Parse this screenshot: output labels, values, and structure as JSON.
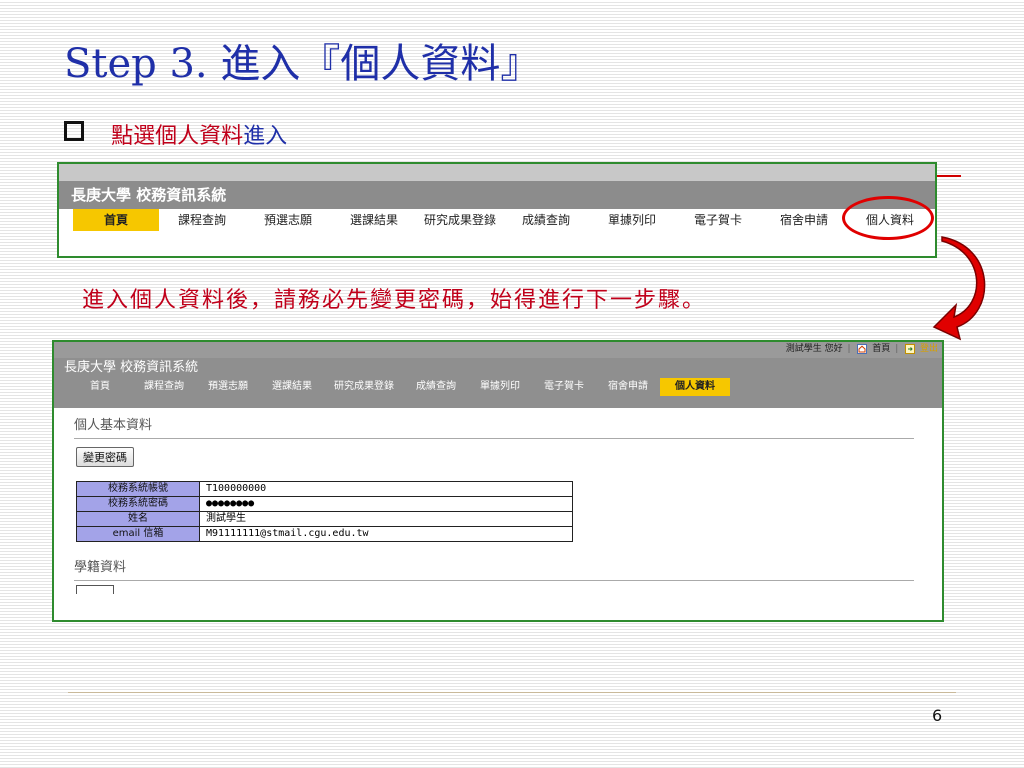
{
  "slide": {
    "title": "Step 3. 進入『個人資料』",
    "bullet_part1": "點選個人資料",
    "bullet_part2": "進入",
    "note": "進入個人資料後，請務必先變更密碼，始得進行下一步驟。",
    "page_number": "6"
  },
  "screenshot1": {
    "system_title": "長庚大學 校務資訊系統",
    "nav": [
      "首頁",
      "課程查詢",
      "預選志願",
      "選課結果",
      "研究成果登錄",
      "成績查詢",
      "單據列印",
      "電子賀卡",
      "宿舍申請",
      "個人資料"
    ],
    "active_index": 0
  },
  "screenshot2": {
    "user_greeting": "測試學生 您好",
    "home_link": "首頁",
    "exit_link": "登出",
    "system_title": "長庚大學 校務資訊系統",
    "nav": [
      "首頁",
      "課程查詢",
      "預選志願",
      "選課結果",
      "研究成果登錄",
      "成績查詢",
      "單據列印",
      "電子賀卡",
      "宿舍申請",
      "個人資料"
    ],
    "active_index": 9,
    "section1_title": "個人基本資料",
    "change_password_button": "變更密碼",
    "info_rows": [
      {
        "label": "校務系統帳號",
        "value": "T100000000"
      },
      {
        "label": "校務系統密碼",
        "value": "●●●●●●●●"
      },
      {
        "label": "姓名",
        "value": "測試學生"
      },
      {
        "label": "email 信箱",
        "value": "M91111111@stmail.cgu.edu.tw"
      }
    ],
    "section2_title": "學籍資料"
  },
  "colors": {
    "title_blue": "#1f2fa8",
    "accent_red": "#c0001a",
    "frame_green": "#2e8b2e",
    "nav_yellow": "#f6c700",
    "header_gray": "#8c8c8c",
    "table_key": "#a3a3e8"
  },
  "icons": [
    "checkbox-bullet",
    "home-icon",
    "exit-icon",
    "curved-arrow-icon"
  ]
}
